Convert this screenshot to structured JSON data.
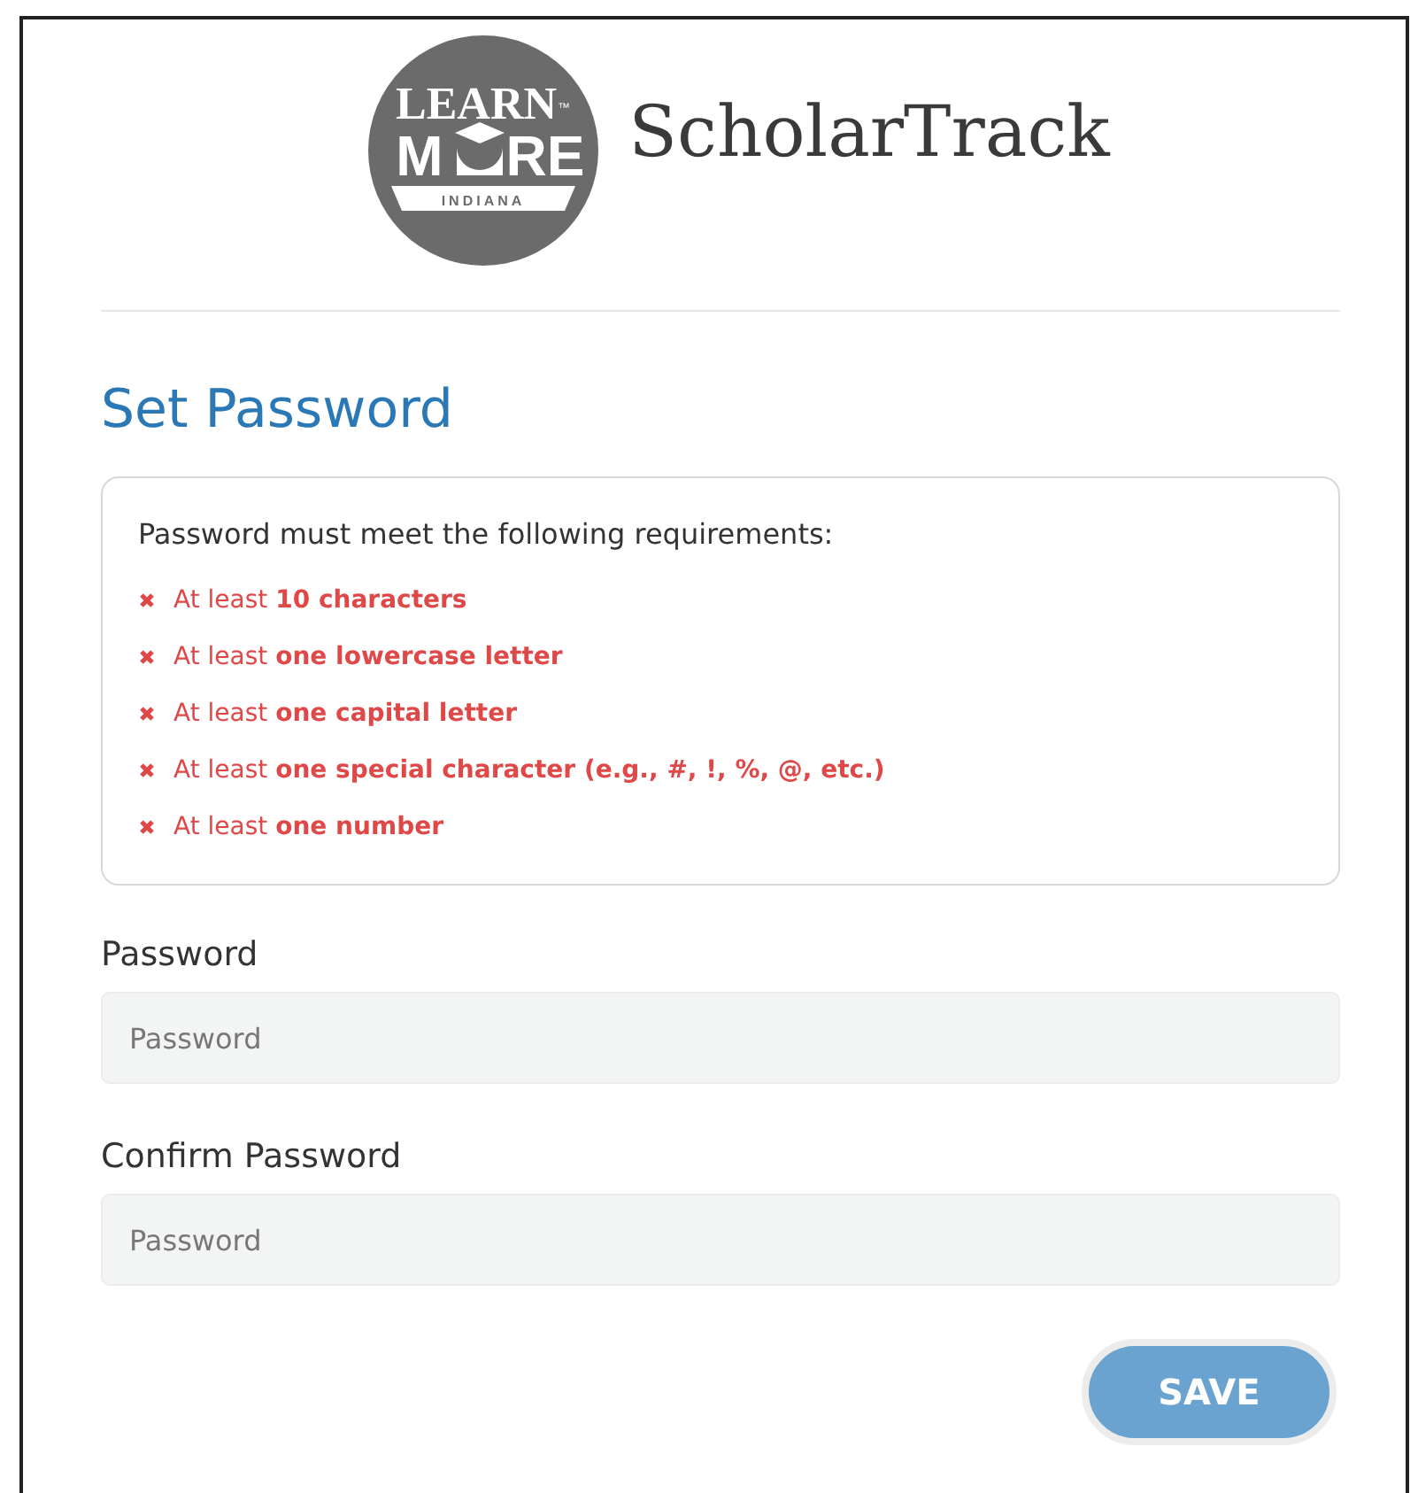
{
  "logo": {
    "line_1": "LEARN",
    "mark": "™",
    "line_2_start": "M",
    "line_2_end": "RE",
    "line_3": "INDIANA"
  },
  "app_title": "ScholarTrack",
  "heading": "Set Password",
  "requirements": {
    "intro": "Password must meet the following requirements:",
    "items": [
      {
        "text": "At least **10 characters**",
        "met": false
      },
      {
        "text": "At least **one lowercase letter**",
        "met": false
      },
      {
        "text": "At least **one capital letter**",
        "met": false
      },
      {
        "text": "At least **one special character (e.g., #, !, %, @, etc.)**",
        "met": false
      },
      {
        "text": "At least **one number**",
        "met": false
      }
    ]
  },
  "fields": [
    {
      "label": "Password",
      "placeholder": "Password"
    },
    {
      "label": "Confirm Password",
      "placeholder": "Password"
    }
  ],
  "save_button": "SAVE"
}
